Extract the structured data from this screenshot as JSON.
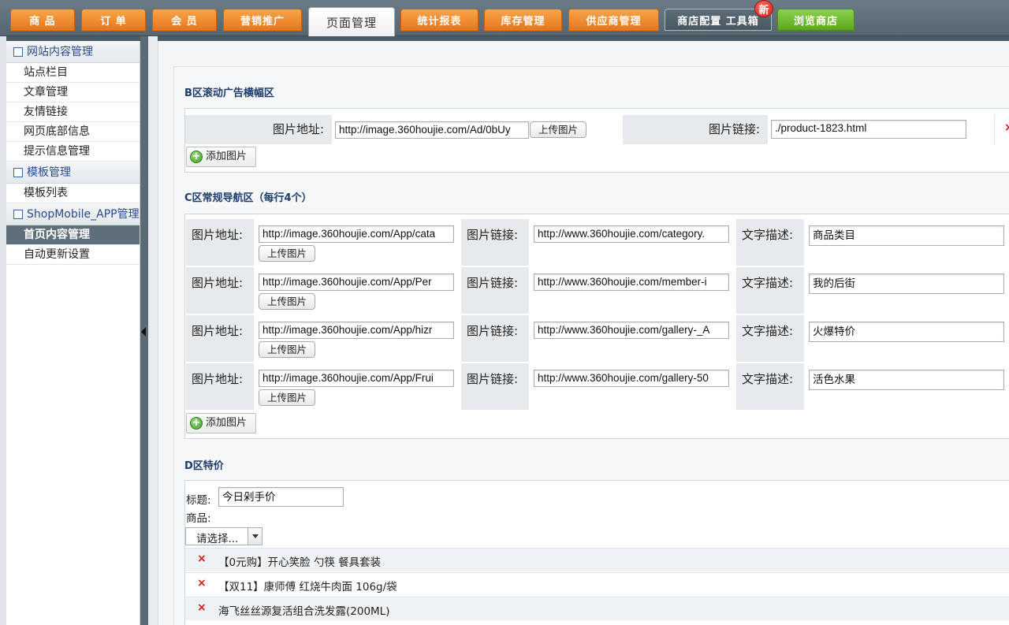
{
  "nav": {
    "tabs": [
      {
        "label": "商 品"
      },
      {
        "label": "订 单"
      },
      {
        "label": "会 员"
      },
      {
        "label": "营销推广"
      },
      {
        "label": "页面管理"
      },
      {
        "label": "统计报表"
      },
      {
        "label": "库存管理"
      },
      {
        "label": "供应商管理"
      },
      {
        "label": "商店配置  工具箱"
      },
      {
        "label": "浏览商店"
      }
    ],
    "new_badge": "新",
    "active_tab": "页面管理"
  },
  "sidebar": {
    "groups": [
      {
        "title": "网站内容管理",
        "items": [
          "站点栏目",
          "文章管理",
          "友情链接",
          "网页底部信息",
          "提示信息管理"
        ]
      },
      {
        "title": "模板管理",
        "items": [
          "模板列表"
        ]
      },
      {
        "title": "ShopMobile_APP管理",
        "items": [
          "首页内容管理",
          "自动更新设置"
        ]
      }
    ],
    "active_item": "首页内容管理"
  },
  "section_b": {
    "title": "B区滚动广告横幅区",
    "image_label": "图片地址:",
    "image_value": "http://image.360houjie.com/Ad/0bUy",
    "upload_label": "上传图片",
    "link_label": "图片链接:",
    "link_value": "./product-1823.html",
    "add_label": "添加图片",
    "delete_icon": "×"
  },
  "section_c": {
    "title": "C区常规导航区（每行4个）",
    "image_label": "图片地址:",
    "link_label": "图片链接:",
    "desc_label": "文字描述:",
    "upload_label": "上传图片",
    "add_label": "添加图片",
    "rows": [
      {
        "image": "http://image.360houjie.com/App/cata",
        "link": "http://www.360houjie.com/category.",
        "desc": "商品类目"
      },
      {
        "image": "http://image.360houjie.com/App/Per",
        "link": "http://www.360houjie.com/member-i",
        "desc": "我的后街"
      },
      {
        "image": "http://image.360houjie.com/App/hizr",
        "link": "http://www.360houjie.com/gallery-_A",
        "desc": "火爆特价"
      },
      {
        "image": "http://image.360houjie.com/App/Frui",
        "link": "http://www.360houjie.com/gallery-50",
        "desc": "活色水果"
      }
    ]
  },
  "section_d": {
    "title": "D区特价",
    "title_label": "标题:",
    "title_value": "今日剁手价",
    "product_label": "商品:",
    "select_value": "请选择...",
    "delete_icon": "×",
    "products": [
      "【0元购】开心笑脸 勺筷 餐具套装",
      "【双11】康师傅 红烧牛肉面 106g/袋",
      "海飞丝丝源复活组合洗发露(200ML)"
    ]
  }
}
